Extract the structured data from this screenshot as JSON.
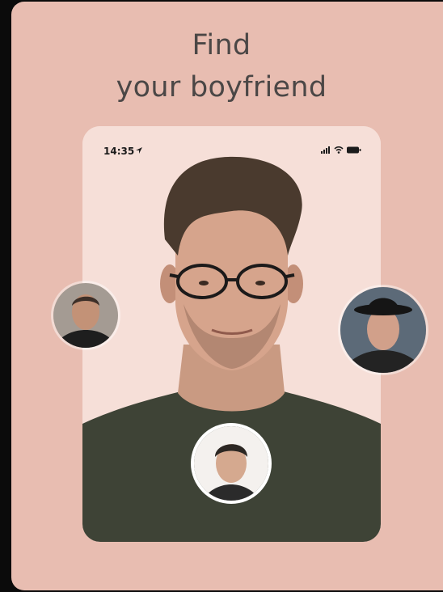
{
  "headline": {
    "line1": "Find",
    "line2": "your boyfriend"
  },
  "phone": {
    "status_time": "14:35"
  },
  "colors": {
    "background": "#e8bdb1",
    "phone_screen": "#f6dfd8",
    "shirt": "#3e4336",
    "text": "#4b4746"
  },
  "icons": [
    "location-arrow-icon",
    "signal-icon",
    "wifi-icon",
    "battery-icon"
  ]
}
